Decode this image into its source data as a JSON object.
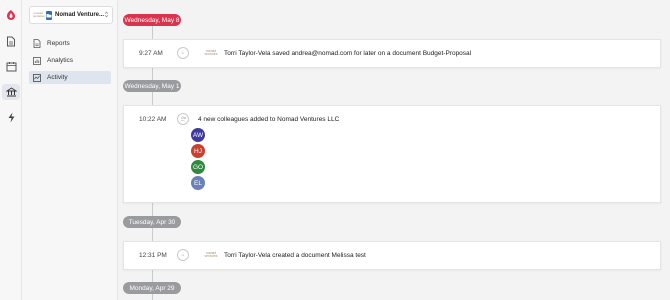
{
  "app": {
    "brand_color": "#e0314f"
  },
  "rail": {
    "items": [
      {
        "name": "brand-logo-icon"
      },
      {
        "name": "document-icon"
      },
      {
        "name": "calendar-icon"
      },
      {
        "name": "bank-icon",
        "active": true
      },
      {
        "name": "lightning-icon"
      }
    ]
  },
  "workspace": {
    "logo_text": "nomad ventures",
    "name": "Nomad Venture...",
    "caret": "⌃⌄"
  },
  "sidebar": {
    "items": [
      {
        "label": "Reports",
        "icon": "document-icon"
      },
      {
        "label": "Analytics",
        "icon": "chart-icon"
      },
      {
        "label": "Activity",
        "icon": "activity-icon",
        "active": true
      }
    ]
  },
  "timeline": {
    "groups": [
      {
        "date": "Wednesday, May 8",
        "color": "#d8344f",
        "events": [
          {
            "time": "9:27 AM",
            "logo_text": "nomad ventures",
            "message": "Torri Taylor-Vela saved andrea@nomad.com for later on a document Budget-Proposal"
          }
        ]
      },
      {
        "date": "Wednesday, May 1",
        "color": "#9a9b9e",
        "events": [
          {
            "time": "10:22 AM",
            "message": "4 new colleagues added to Nomad Ventures LLC",
            "avatars": [
              {
                "initials": "AW",
                "color": "#3f3a9e"
              },
              {
                "initials": "HJ",
                "color": "#c8402e"
              },
              {
                "initials": "GO",
                "color": "#2f8a3e"
              },
              {
                "initials": "EL",
                "color": "#6a80b8"
              }
            ]
          }
        ]
      },
      {
        "date": "Tuesday, Apr 30",
        "color": "#9a9b9e",
        "events": [
          {
            "time": "12:31 PM",
            "logo_text": "nomad ventures",
            "message": "Torri Taylor-Vela created a document Melissa test"
          }
        ]
      },
      {
        "date": "Monday, Apr 29",
        "color": "#9a9b9e",
        "events": []
      }
    ]
  }
}
